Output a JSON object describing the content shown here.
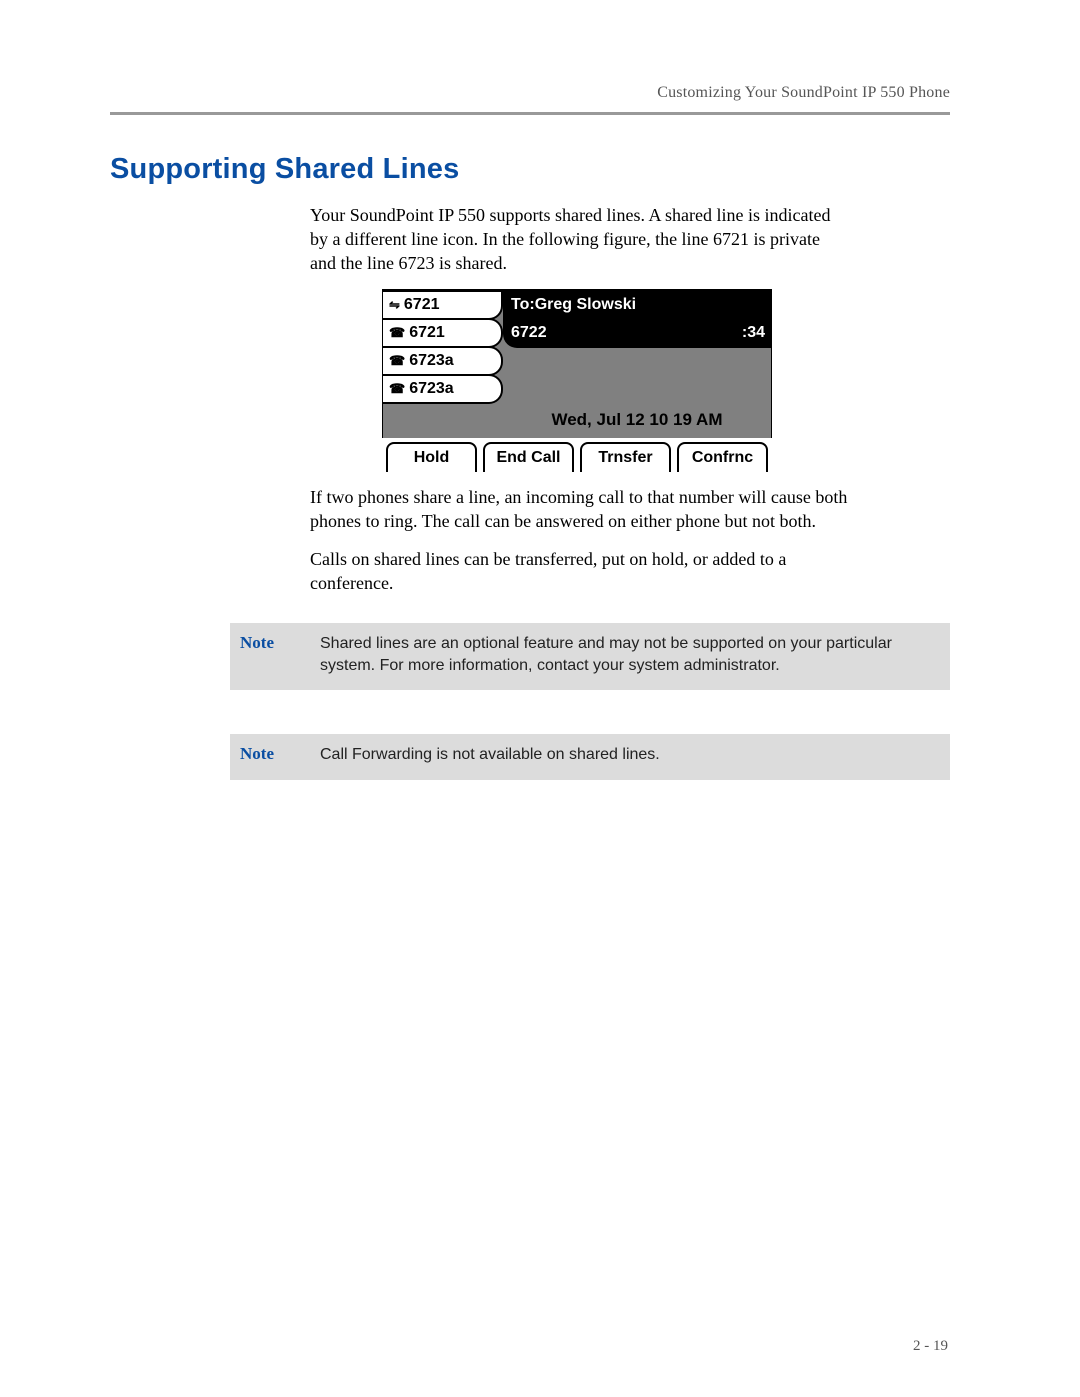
{
  "header": {
    "running_head": "Customizing Your SoundPoint IP 550 Phone"
  },
  "section_title": "Supporting Shared Lines",
  "paragraphs": {
    "p1": "Your SoundPoint IP 550 supports shared lines. A shared line is indicated by a different line icon. In the following figure, the line 6721 is private and the line 6723 is shared.",
    "p2": "If two phones share a line, an incoming call to that number will cause both phones to ring. The call can be answered on either phone but not both.",
    "p3": "Calls on shared lines can be transferred, put on hold, or added to a conference."
  },
  "phone": {
    "lines": [
      {
        "icon": "shared-icon",
        "glyph": "⇋",
        "label": "6721"
      },
      {
        "icon": "phone-icon",
        "glyph": "☎",
        "label": "6721"
      },
      {
        "icon": "phone-icon",
        "glyph": "☎",
        "label": "6723a"
      },
      {
        "icon": "phone-icon",
        "glyph": "☎",
        "label": "6723a"
      }
    ],
    "call_to": "To:Greg Slowski",
    "call_number": "6722",
    "call_timer": ":34",
    "datetime": "Wed, Jul 12  10 19 AM",
    "softkeys": [
      "Hold",
      "End Call",
      "Trnsfer",
      "Confrnc"
    ]
  },
  "notes": [
    {
      "label": "Note",
      "text": "Shared lines are an optional feature and may not be supported on your particular system. For more information, contact your system administrator."
    },
    {
      "label": "Note",
      "text": "Call Forwarding is not available on shared lines."
    }
  ],
  "page_number": "2 - 19"
}
